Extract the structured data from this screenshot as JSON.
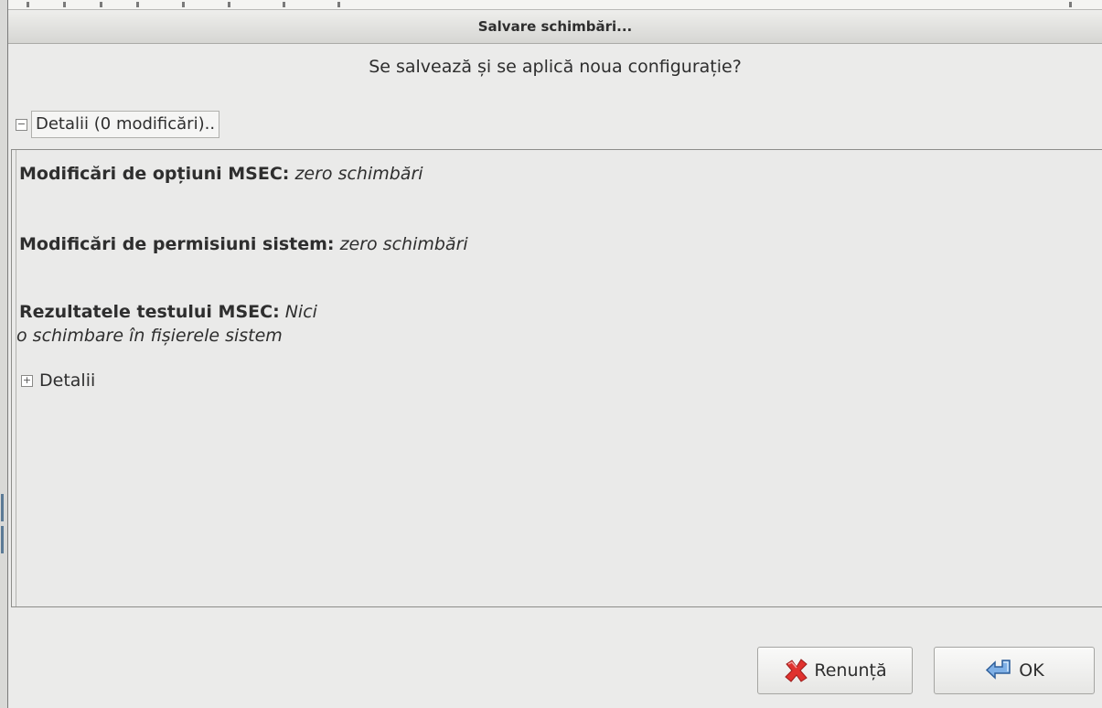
{
  "dialog": {
    "title": "Salvare schimbări...",
    "question": "Se salvează și se aplică noua configurație?"
  },
  "details_expander": {
    "toggle_symbol": "−",
    "label": "Detalii (0 modificări).."
  },
  "details_panel": {
    "msec_options": {
      "label": "Modificări de opțiuni MSEC:",
      "value": "zero schimbări"
    },
    "system_permissions": {
      "label": "Modificări de permisiuni sistem:",
      "value": "zero schimbări"
    },
    "msec_test_results": {
      "label": "Rezultatele testului MSEC:",
      "value_line1": "Nici",
      "value_line2": "o schimbare în fișierele sistem"
    },
    "sub_expander": {
      "toggle_symbol": "+",
      "label": "Detalii"
    }
  },
  "buttons": {
    "cancel": {
      "label": "Renunță",
      "icon": "red-x-icon"
    },
    "ok": {
      "label": "OK",
      "icon": "enter-arrow-icon"
    }
  },
  "colors": {
    "background": "#ebebea",
    "text": "#2e2e2e",
    "cancel_icon": "#e0322e",
    "ok_icon": "#4a7fc0"
  }
}
